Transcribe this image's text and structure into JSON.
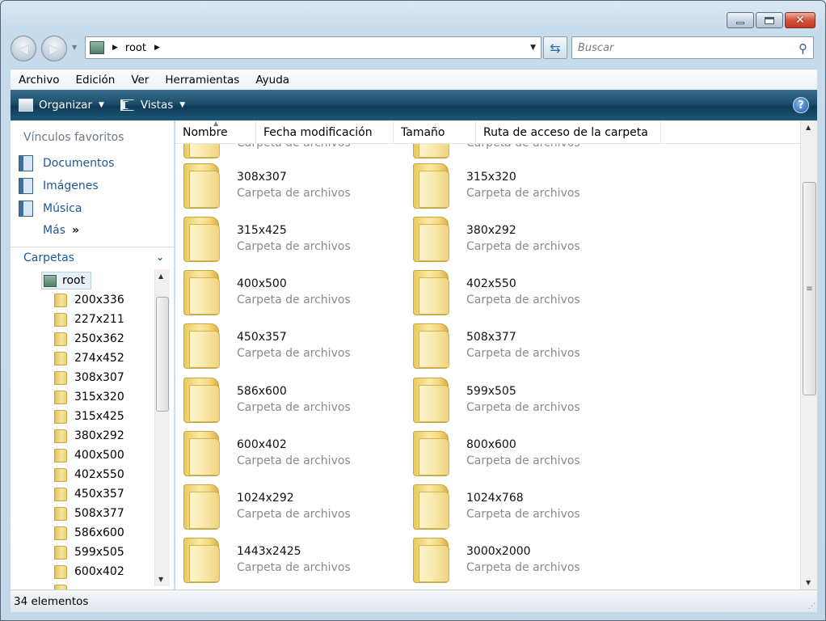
{
  "window": {
    "minimize_glyph": "",
    "close_glyph": "✕"
  },
  "nav": {
    "back_glyph": "◀",
    "forward_glyph": "▶"
  },
  "address": {
    "segment": "root",
    "icon": "drive-folder-icon"
  },
  "search": {
    "placeholder": "Buscar"
  },
  "menu": [
    "Archivo",
    "Edición",
    "Ver",
    "Herramientas",
    "Ayuda"
  ],
  "toolbar": {
    "organize_label": "Organizar",
    "views_label": "Vistas",
    "help_glyph": "?"
  },
  "sidebar": {
    "favorites_title": "Vínculos favoritos",
    "favorites": [
      {
        "label": "Documentos",
        "icon": "documents-icon"
      },
      {
        "label": "Imágenes",
        "icon": "pictures-icon"
      },
      {
        "label": "Música",
        "icon": "music-icon"
      }
    ],
    "more_label": "Más",
    "more_glyph": "»",
    "folders_title": "Carpetas",
    "folders_chevron": "⌄",
    "tree_root": "root",
    "tree": [
      "200x336",
      "227x211",
      "250x362",
      "274x452",
      "308x307",
      "315x320",
      "315x425",
      "380x292",
      "400x500",
      "402x550",
      "450x357",
      "508x377",
      "586x600",
      "599x505",
      "600x402"
    ]
  },
  "columns": [
    "Nombre",
    "Fecha modificación",
    "Tamaño",
    "Ruta de acceso de la carpeta"
  ],
  "files": {
    "subtitle": "Carpeta de archivos",
    "partial": [
      "",
      ""
    ],
    "items": [
      "308x307",
      "315x320",
      "315x425",
      "380x292",
      "400x500",
      "402x550",
      "450x357",
      "508x377",
      "586x600",
      "599x505",
      "600x402",
      "800x600",
      "1024x292",
      "1024x768",
      "1443x2425",
      "3000x2000"
    ]
  },
  "status": {
    "count_label": "34 elementos"
  },
  "colors": {
    "toolbar": "#1d4d6c",
    "link": "#1e5796",
    "subtitle": "#8a8a8a"
  }
}
